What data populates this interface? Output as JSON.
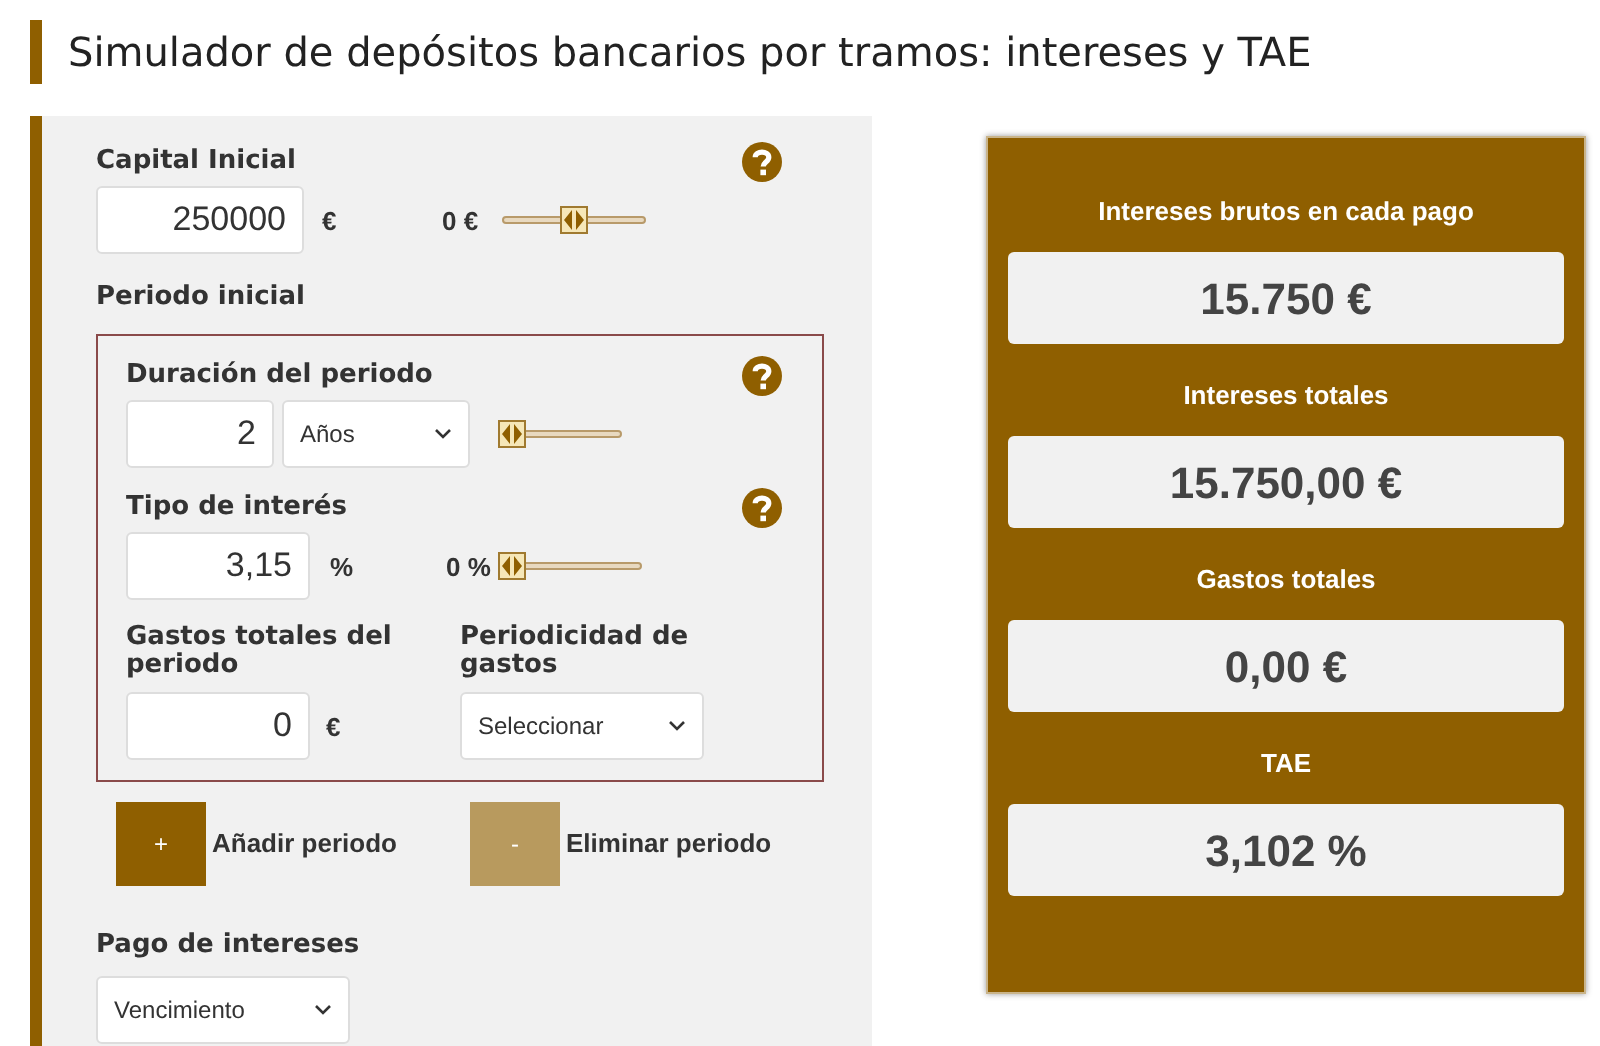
{
  "title": "Simulador de depósitos bancarios por tramos: intereses y TAE",
  "capital": {
    "label": "Capital Inicial",
    "value": "250000",
    "unit": "€",
    "slider_reading": "0 €",
    "level": 0.5
  },
  "period": {
    "heading": "Periodo inicial",
    "duration": {
      "label": "Duración del periodo",
      "value": "2",
      "unit_select": "Años",
      "level": 0
    },
    "interest": {
      "label": "Tipo de interés",
      "value": "3,15",
      "unit": "%",
      "slider_reading": "0 %",
      "level": 0
    },
    "costs": {
      "label": "Gastos totales del periodo",
      "value": "0",
      "unit": "€"
    },
    "cost_frequency": {
      "label": "Periodicidad de gastos",
      "select": "Seleccionar"
    }
  },
  "period_buttons": [
    {
      "symbol": "+",
      "label": "Añadir periodo",
      "disabled": false
    },
    {
      "symbol": "-",
      "label": "Eliminar periodo",
      "disabled": true
    }
  ],
  "interest_payment": {
    "label": "Pago de intereses",
    "select": "Vencimiento"
  },
  "results": [
    {
      "label": "Intereses brutos en cada pago",
      "value": "15.750 €"
    },
    {
      "label": "Intereses totales",
      "value": "15.750,00 €"
    },
    {
      "label": "Gastos totales",
      "value": "0,00 €"
    },
    {
      "label": "TAE",
      "value": "3,102 %"
    }
  ]
}
